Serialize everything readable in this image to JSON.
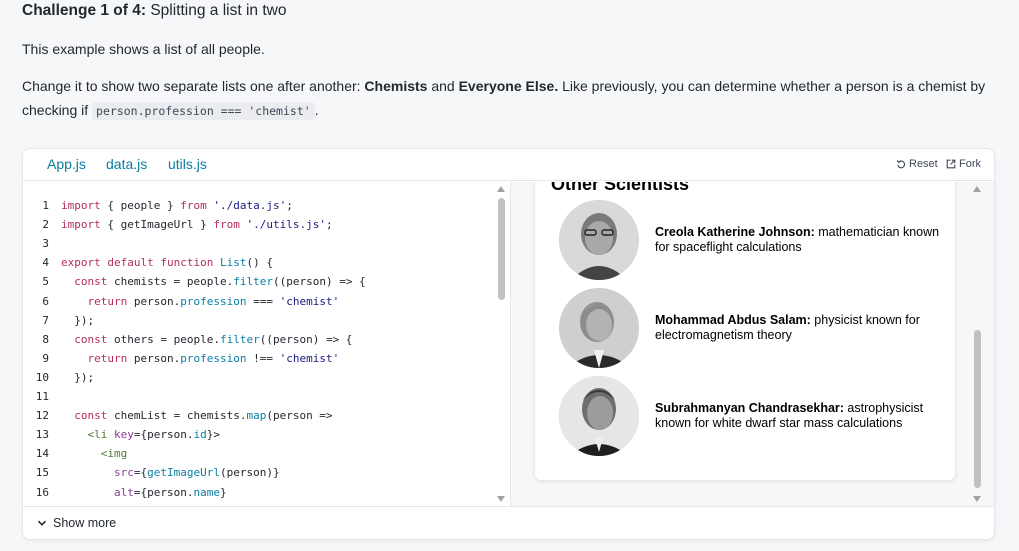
{
  "challenge": {
    "prefix": "Challenge 1 of 4:",
    "title": "Splitting a list in two"
  },
  "intro": "This example shows a list of all people.",
  "instructions": {
    "part1": "Change it to show two separate lists one after another: ",
    "chemists": "Chemists",
    "and": " and ",
    "everyone_else": "Everyone Else.",
    "part2": " Like previously, you can determine whether a person is a chemist by checking if ",
    "code": "person.profession === 'chemist'",
    "end": "."
  },
  "tabs": [
    "App.js",
    "data.js",
    "utils.js"
  ],
  "actions": {
    "reset": "Reset",
    "fork": "Fork"
  },
  "code_lines": [
    [
      [
        "kw",
        "import"
      ],
      [
        "pl",
        " { people } "
      ],
      [
        "kw",
        "from"
      ],
      [
        "pl",
        " "
      ],
      [
        "str",
        "'./data.js'"
      ],
      [
        "pl",
        ";"
      ]
    ],
    [
      [
        "kw",
        "import"
      ],
      [
        "pl",
        " { getImageUrl } "
      ],
      [
        "kw",
        "from"
      ],
      [
        "pl",
        " "
      ],
      [
        "str",
        "'./utils.js'"
      ],
      [
        "pl",
        ";"
      ]
    ],
    [],
    [
      [
        "kw",
        "export default function"
      ],
      [
        "pl",
        " "
      ],
      [
        "fn",
        "List"
      ],
      [
        "pl",
        "() {"
      ]
    ],
    [
      [
        "pl",
        "  "
      ],
      [
        "kw",
        "const"
      ],
      [
        "pl",
        " chemists = people."
      ],
      [
        "fn",
        "filter"
      ],
      [
        "pl",
        "((person) => {"
      ]
    ],
    [
      [
        "pl",
        "    "
      ],
      [
        "kw",
        "return"
      ],
      [
        "pl",
        " person."
      ],
      [
        "fn",
        "profession"
      ],
      [
        "pl",
        " === "
      ],
      [
        "str",
        "'chemist'"
      ]
    ],
    [
      [
        "pl",
        "  });"
      ]
    ],
    [
      [
        "pl",
        "  "
      ],
      [
        "kw",
        "const"
      ],
      [
        "pl",
        " others = people."
      ],
      [
        "fn",
        "filter"
      ],
      [
        "pl",
        "((person) => {"
      ]
    ],
    [
      [
        "pl",
        "    "
      ],
      [
        "kw",
        "return"
      ],
      [
        "pl",
        " person."
      ],
      [
        "fn",
        "profession"
      ],
      [
        "pl",
        " !== "
      ],
      [
        "str",
        "'chemist'"
      ]
    ],
    [
      [
        "pl",
        "  });"
      ]
    ],
    [],
    [
      [
        "pl",
        "  "
      ],
      [
        "kw",
        "const"
      ],
      [
        "pl",
        " chemList = chemists."
      ],
      [
        "fn",
        "map"
      ],
      [
        "pl",
        "(person =>"
      ]
    ],
    [
      [
        "pl",
        "    "
      ],
      [
        "tag",
        "<li"
      ],
      [
        "pl",
        " "
      ],
      [
        "attr",
        "key"
      ],
      [
        "pl",
        "={person."
      ],
      [
        "fn",
        "id"
      ],
      [
        "pl",
        "}>"
      ]
    ],
    [
      [
        "pl",
        "      "
      ],
      [
        "tag",
        "<img"
      ]
    ],
    [
      [
        "pl",
        "        "
      ],
      [
        "attr",
        "src"
      ],
      [
        "pl",
        "={"
      ],
      [
        "fn",
        "getImageUrl"
      ],
      [
        "pl",
        "(person)}"
      ]
    ],
    [
      [
        "pl",
        "        "
      ],
      [
        "attr",
        "alt"
      ],
      [
        "pl",
        "={person."
      ],
      [
        "fn",
        "name"
      ],
      [
        "pl",
        "}"
      ]
    ]
  ],
  "preview": {
    "heading": "Other Scientists",
    "people": [
      {
        "name": "Creola Katherine Johnson:",
        "desc": " mathematician known for spaceflight calculations"
      },
      {
        "name": "Mohammad Abdus Salam:",
        "desc": " physicist known for electromagnetism theory"
      },
      {
        "name": "Subrahmanyan Chandrasekhar:",
        "desc": " astrophysicist known for white dwarf star mass calculations"
      }
    ]
  },
  "footer": {
    "show_more": "Show more"
  },
  "colors": {
    "accent": "#087ea4",
    "keyword": "#b52d62",
    "string": "#1a1a80"
  },
  "icons": [
    "reset-icon",
    "fork-icon",
    "chevron-down-icon"
  ]
}
